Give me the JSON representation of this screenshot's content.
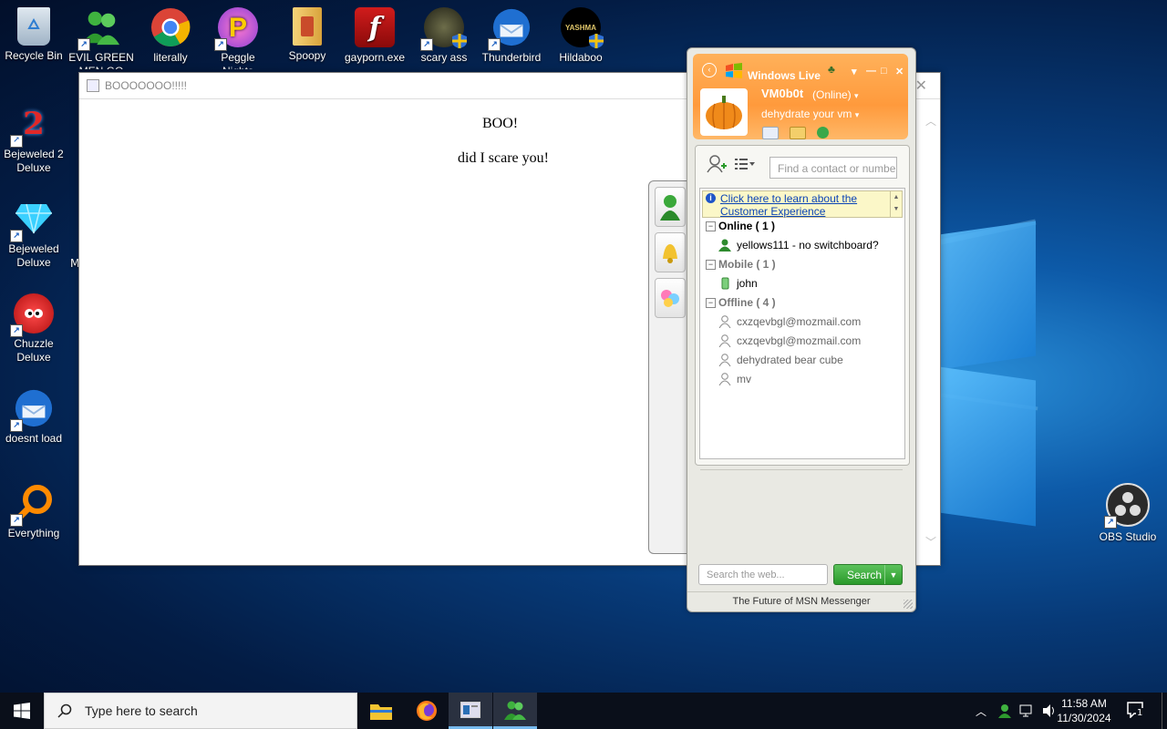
{
  "desktop": {
    "icons": [
      {
        "label": "Recycle Bin",
        "icon": "recycle-bin-icon"
      },
      {
        "label": "EVIL GREEN MEN GO",
        "icon": "msn-people-icon"
      },
      {
        "label": "literally",
        "icon": "chrome-icon"
      },
      {
        "label": "Peggle Nights",
        "icon": "peggle-icon"
      },
      {
        "label": "Spoopy",
        "icon": "folder-icon"
      },
      {
        "label": "gayporn.exe",
        "icon": "flash-icon"
      },
      {
        "label": "scary ass",
        "icon": "scary-game-icon"
      },
      {
        "label": "Thunderbird",
        "icon": "thunderbird-icon"
      },
      {
        "label": "Hildaboo",
        "icon": "yashma-icon"
      },
      {
        "label": "Bejeweled 2 Deluxe",
        "icon": "bejeweled2-icon"
      },
      {
        "label": "Bejeweled Deluxe",
        "icon": "gem-icon"
      },
      {
        "label": "Chuzzle Deluxe",
        "icon": "chuzzle-icon"
      },
      {
        "label": "doesnt load",
        "icon": "thunderbird-icon"
      },
      {
        "label": "Everything",
        "icon": "search-magnifier-icon"
      },
      {
        "label": "OBS Studio",
        "icon": "obs-icon"
      }
    ],
    "partial_label": "M"
  },
  "popup_window": {
    "title": "BOOOOOOO!!!!!",
    "close_glyph": "✕",
    "heading": "BOO!",
    "text": "did I scare you!"
  },
  "messenger": {
    "brand": "Windows Live",
    "user": {
      "name": "VM0b0t",
      "status": "(Online)",
      "personal_message": "dehydrate your vm"
    },
    "find_placeholder": "Find a contact or number",
    "banner_text": "Click here to learn about the Customer Experience",
    "groups": [
      {
        "label": "Online ( 1 )",
        "contacts": [
          "yellows111 - no switchboard?"
        ]
      },
      {
        "label": "Mobile ( 1 )",
        "contacts": [
          "john"
        ]
      },
      {
        "label": "Offline ( 4 )",
        "contacts": [
          "cxzqevbgl@mozmail.com",
          "cxzqevbgl@mozmail.com",
          "dehydrated bear cube",
          "mv"
        ]
      }
    ],
    "search_placeholder": "Search the web...",
    "search_button": "Search",
    "footer": "The Future of MSN Messenger",
    "colors": {
      "header_orange": "#ff9a3c",
      "online_green": "#2e8b2e",
      "search_green": "#2a9a2a"
    }
  },
  "taskbar": {
    "search_placeholder": "Type here to search",
    "time": "11:58 AM",
    "date": "11/30/2024",
    "notification_count": "1"
  }
}
